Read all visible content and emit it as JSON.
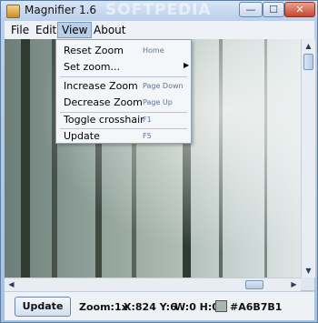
{
  "window": {
    "title": "Magnifier 1.6",
    "watermark": "SOFTPEDIA",
    "min_glyph": "—",
    "max_glyph": "☐",
    "close_glyph": "✕"
  },
  "menubar": {
    "file": "File",
    "edit": "Edit",
    "view": "View",
    "about": "About"
  },
  "view_menu": {
    "items": [
      {
        "label": "Reset Zoom",
        "accel": "Home",
        "submenu": false
      },
      {
        "label": "Set zoom...",
        "accel": "",
        "submenu": true
      },
      {
        "label": "Increase Zoom",
        "accel": "Page Down",
        "submenu": false
      },
      {
        "label": "Decrease Zoom",
        "accel": "Page Up",
        "submenu": false
      },
      {
        "label": "Toggle crosshair",
        "accel": "F1",
        "submenu": false
      },
      {
        "label": "Update",
        "accel": "F5",
        "submenu": false
      }
    ]
  },
  "status": {
    "update_label": "Update",
    "zoom": "Zoom:1x",
    "xy": "X:824 Y:6",
    "wh": "W:0 H:0",
    "color_hex": "#A6B7B1",
    "swatch_color": "#A6B7B1"
  },
  "icons": {
    "submenu_arrow": "▶",
    "scroll_up": "▲",
    "scroll_down": "▼",
    "scroll_left": "◀",
    "scroll_right": "▶"
  }
}
